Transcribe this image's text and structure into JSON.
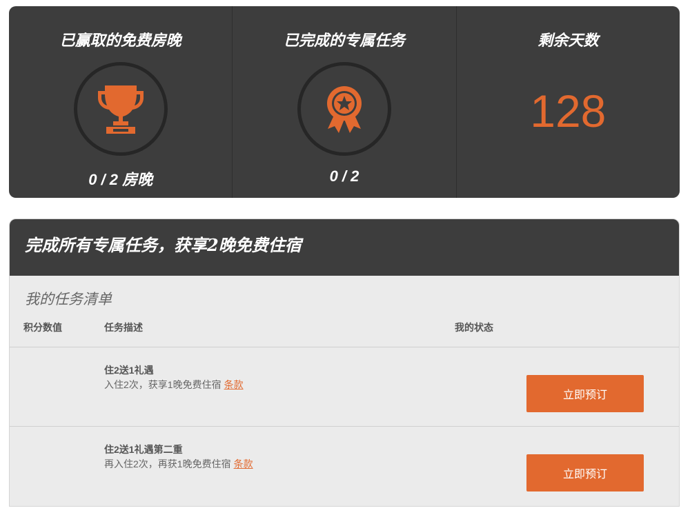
{
  "stats": [
    {
      "title": "已赢取的免费房晚",
      "icon": "trophy-icon",
      "value": "0 / 2 房晚"
    },
    {
      "title": "已完成的专属任务",
      "icon": "award-ribbon-icon",
      "value": "0 / 2"
    },
    {
      "title": "剩余天数",
      "value": "128"
    }
  ],
  "panel": {
    "header": "完成所有专属任务，获享2晚免费住宿",
    "list_title": "我的任务清单",
    "columns": [
      "积分数值",
      "任务描述",
      "我的状态"
    ],
    "tasks": [
      {
        "name": "住2送1礼遇",
        "description": "入住2次，获享1晚免费住宿",
        "terms": "条款",
        "button": "立即预订"
      },
      {
        "name": "住2送1礼遇第二重",
        "description": "再入住2次，再获1晚免费住宿",
        "terms": "条款",
        "button": "立即预订"
      }
    ]
  },
  "colors": {
    "accent": "#e2692f",
    "dark_panel": "#3d3d3d",
    "list_bg": "#ebebeb"
  }
}
